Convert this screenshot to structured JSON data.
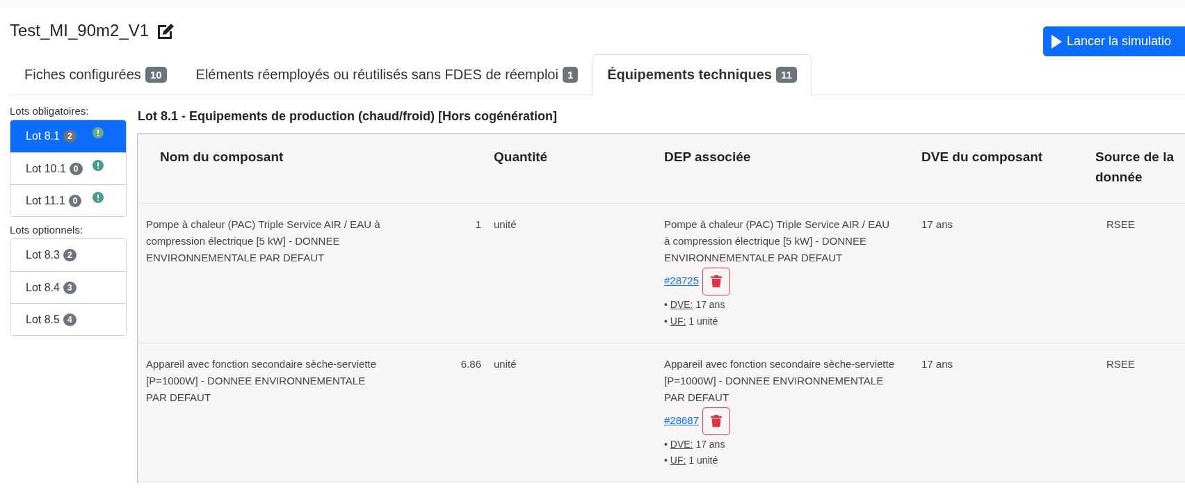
{
  "title": "Test_MI_90m2_V1",
  "run_button": {
    "label": "Lancer la simulatio"
  },
  "tabs": [
    {
      "label": "Fiches configurées",
      "count": "10",
      "selected": false
    },
    {
      "label": "Eléments réemployés ou réutilisés sans FDES de réemploi",
      "count": "1",
      "selected": false
    },
    {
      "label": "Équipements techniques",
      "count": "11",
      "selected": true
    }
  ],
  "sidebar": {
    "groups": [
      {
        "label": "Lots obligatoires:",
        "items": [
          {
            "label": "Lot 8.1",
            "count": "2",
            "selected": true,
            "warning": true
          },
          {
            "label": "Lot 10.1",
            "count": "0",
            "selected": false,
            "warning": true
          },
          {
            "label": "Lot 11.1",
            "count": "0",
            "selected": false,
            "warning": true
          }
        ]
      },
      {
        "label": "Lots optionnels:",
        "items": [
          {
            "label": "Lot 8.3",
            "count": "2",
            "selected": false,
            "warning": false
          },
          {
            "label": "Lot 8.4",
            "count": "3",
            "selected": false,
            "warning": false
          },
          {
            "label": "Lot 8.5",
            "count": "4",
            "selected": false,
            "warning": false
          }
        ]
      }
    ]
  },
  "section_title": "Lot 8.1 - Equipements de production (chaud/froid) [Hors cogénération]",
  "table": {
    "columns": [
      "Nom du composant",
      "Quantité",
      "DEP associée",
      "DVE du composant",
      "Source de la donnée"
    ],
    "rows": [
      {
        "name": "Pompe à chaleur (PAC) Triple Service AIR / EAU à compression électrique [5 kW] - DONNEE ENVIRONNEMENTALE PAR DEFAUT",
        "quantity": "1",
        "unit": "unité",
        "dep": {
          "text": "Pompe à chaleur (PAC) Triple Service AIR / EAU à compression électrique [5 kW] - DONNEE ENVIRONNEMENTALE PAR DEFAUT",
          "link": "#28725",
          "details": [
            {
              "bullet": "•",
              "label": "DVE:",
              "value": "17 ans"
            },
            {
              "bullet": "•",
              "label": "UF:",
              "value": "1 unité"
            }
          ]
        },
        "dve": "17 ans",
        "source": "RSEE"
      },
      {
        "name": "Appareil avec fonction secondaire sèche-serviette [P=1000W] - DONNEE ENVIRONNEMENTALE PAR DEFAUT",
        "quantity": "6.86",
        "unit": "unité",
        "dep": {
          "text": "Appareil avec fonction secondaire sèche-serviette [P=1000W] - DONNEE ENVIRONNEMENTALE PAR DEFAUT ",
          "link": "#28687",
          "details": [
            {
              "bullet": "•",
              "label": "DVE:",
              "value": "17 ans"
            },
            {
              "bullet": "•",
              "label": "UF:",
              "value": "1 unité"
            }
          ]
        },
        "dve": "17 ans",
        "source": "RSEE"
      }
    ]
  }
}
